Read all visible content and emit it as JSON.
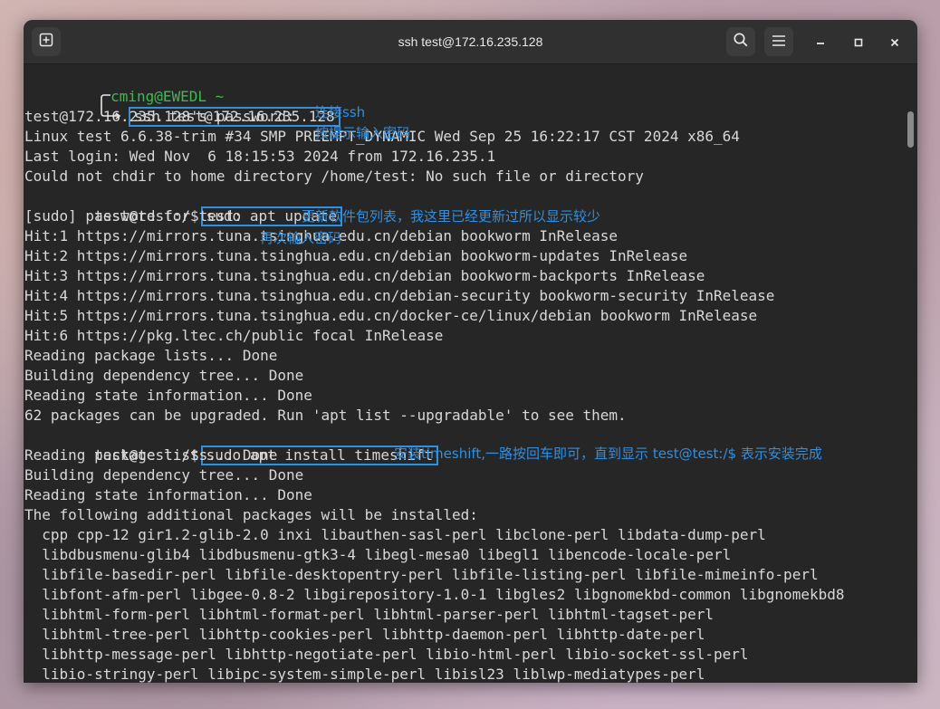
{
  "window": {
    "title": "ssh test@172.16.235.128"
  },
  "icons": {
    "new_tab": "plus-square-icon",
    "search": "search-icon",
    "menu": "hamburger-icon",
    "minimize": "minimize-icon",
    "maximize": "maximize-icon",
    "close": "close-icon"
  },
  "terminal": {
    "prompt_user": "cming@EWEDL ~",
    "lines": [
      "ssh test@172.16.235.128",
      "test@172.16.235.128's password:",
      "Linux test 6.6.38-trim #34 SMP PREEMPT_DYNAMIC Wed Sep 25 16:22:17 CST 2024 x86_64",
      "Last login: Wed Nov  6 18:15:53 2024 from 172.16.235.1",
      "Could not chdir to home directory /home/test: No such file or directory",
      "test@test:/$",
      "sudo apt update",
      "[sudo] password for test:",
      "Hit:1 https://mirrors.tuna.tsinghua.edu.cn/debian bookworm InRelease",
      "Hit:2 https://mirrors.tuna.tsinghua.edu.cn/debian bookworm-updates InRelease",
      "Hit:3 https://mirrors.tuna.tsinghua.edu.cn/debian bookworm-backports InRelease",
      "Hit:4 https://mirrors.tuna.tsinghua.edu.cn/debian-security bookworm-security InRelease",
      "Hit:5 https://mirrors.tuna.tsinghua.edu.cn/docker-ce/linux/debian bookworm InRelease",
      "Hit:6 https://pkg.ltec.ch/public focal InRelease",
      "Reading package lists... Done",
      "Building dependency tree... Done",
      "Reading state information... Done",
      "62 packages can be upgraded. Run 'apt list --upgradable' to see them.",
      "test@test:/$",
      "sudo apt install timeshift",
      "Reading package lists... Done",
      "Building dependency tree... Done",
      "Reading state information... Done",
      "The following additional packages will be installed:",
      "  cpp cpp-12 gir1.2-glib-2.0 inxi libauthen-sasl-perl libclone-perl libdata-dump-perl",
      "  libdbusmenu-glib4 libdbusmenu-gtk3-4 libegl-mesa0 libegl1 libencode-locale-perl",
      "  libfile-basedir-perl libfile-desktopentry-perl libfile-listing-perl libfile-mimeinfo-perl",
      "  libfont-afm-perl libgee-0.8-2 libgirepository-1.0-1 libgles2 libgnomekbd-common libgnomekbd8",
      "  libhtml-form-perl libhtml-format-perl libhtml-parser-perl libhtml-tagset-perl",
      "  libhtml-tree-perl libhttp-cookies-perl libhttp-daemon-perl libhttp-date-perl",
      "  libhttp-message-perl libhttp-negotiate-perl libio-html-perl libio-socket-ssl-perl",
      "  libio-stringy-perl libipc-system-simple-perl libisl23 liblwp-mediatypes-perl"
    ]
  },
  "annotations": {
    "connect_ssh": "连接ssh",
    "enter_password": "按提示输入密码",
    "update_note": "更新软件包列表，我这里已经更新过所以显示较少",
    "reenter_password": "再次输入密码",
    "install_note": "安装timeshift,一路按回车即可，直到显示 test@test:/$ 表示安装完成"
  },
  "colors": {
    "prompt_green": "#3fb950",
    "annotation_blue": "#2f8fe0",
    "terminal_bg": "#262626",
    "terminal_text": "#d8d8d8"
  }
}
